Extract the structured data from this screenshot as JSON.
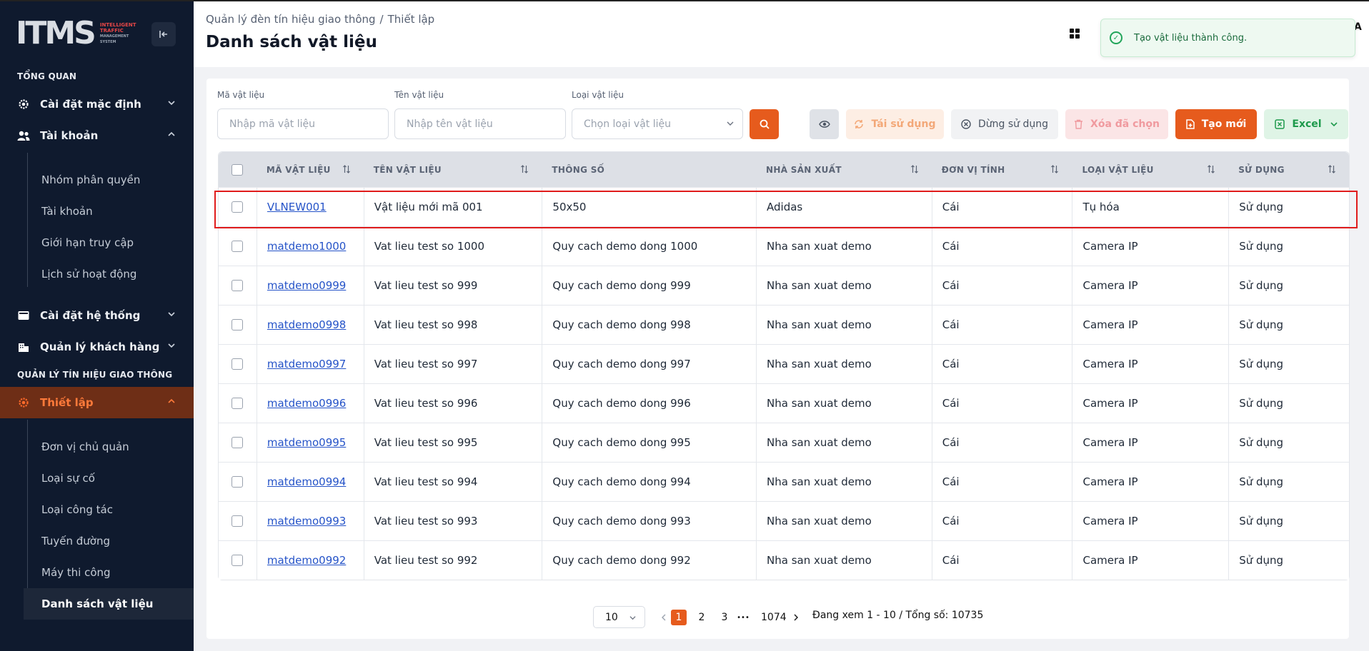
{
  "app": {
    "logo_text": "ITMS",
    "logo_sub": [
      "INTELLIGENT",
      "TRAFFIC",
      "MANAGEMENT",
      "SYSTEM"
    ]
  },
  "sidebar": {
    "section_overview": "TỔNG QUAN",
    "default_settings": "Cài đặt mặc định",
    "account_group": "Tài khoản",
    "account_items": [
      "Nhóm phân quyền",
      "Tài khoản",
      "Giới hạn truy cập",
      "Lịch sử hoạt động"
    ],
    "system_settings": "Cài đặt hệ thống",
    "customer_mgmt": "Quản lý khách hàng",
    "section_traffic": "QUẢN LÝ TÍN HIỆU GIAO THÔNG",
    "setup_group": "Thiết lập",
    "setup_items": [
      "Đơn vị chủ quản",
      "Loại sự cố",
      "Loại công tác",
      "Tuyến đường",
      "Máy thi công",
      "Danh sách vật liệu"
    ]
  },
  "header": {
    "breadcrumb": [
      "Quản lý đèn tín hiệu giao thông",
      "Thiết lập"
    ],
    "breadcrumb_sep": "/",
    "title": "Danh sách vật liệu",
    "user_initial": "A"
  },
  "toast": {
    "message": "Tạo vật liệu thành công."
  },
  "filters": {
    "code_label": "Mã vật liệu",
    "code_placeholder": "Nhập mã vật liệu",
    "name_label": "Tên vật liệu",
    "name_placeholder": "Nhập tên vật liệu",
    "type_label": "Loại vật liệu",
    "type_placeholder": "Chọn loại vật liệu"
  },
  "toolbar": {
    "reuse": "Tái sử dụng",
    "stop_use": "Dừng sử dụng",
    "delete_selected": "Xóa đã chọn",
    "create_new": "Tạo mới",
    "excel": "Excel"
  },
  "table": {
    "columns": [
      "MÃ VẬT LIỆU",
      "TÊN VẬT LIỆU",
      "THÔNG SỐ",
      "NHÀ SẢN XUẤT",
      "ĐƠN VỊ TÍNH",
      "LOẠI VẬT LIỆU",
      "SỬ DỤNG"
    ],
    "rows": [
      [
        "VLNEW001",
        "Vật liệu mới mã 001",
        "50x50",
        "Adidas",
        "Cái",
        "Tụ hóa",
        "Sử dụng"
      ],
      [
        "matdemo1000",
        "Vat lieu test so 1000",
        "Quy cach demo dong 1000",
        "Nha san xuat demo",
        "Cái",
        "Camera IP",
        "Sử dụng"
      ],
      [
        "matdemo0999",
        "Vat lieu test so 999",
        "Quy cach demo dong 999",
        "Nha san xuat demo",
        "Cái",
        "Camera IP",
        "Sử dụng"
      ],
      [
        "matdemo0998",
        "Vat lieu test so 998",
        "Quy cach demo dong 998",
        "Nha san xuat demo",
        "Cái",
        "Camera IP",
        "Sử dụng"
      ],
      [
        "matdemo0997",
        "Vat lieu test so 997",
        "Quy cach demo dong 997",
        "Nha san xuat demo",
        "Cái",
        "Camera IP",
        "Sử dụng"
      ],
      [
        "matdemo0996",
        "Vat lieu test so 996",
        "Quy cach demo dong 996",
        "Nha san xuat demo",
        "Cái",
        "Camera IP",
        "Sử dụng"
      ],
      [
        "matdemo0995",
        "Vat lieu test so 995",
        "Quy cach demo dong 995",
        "Nha san xuat demo",
        "Cái",
        "Camera IP",
        "Sử dụng"
      ],
      [
        "matdemo0994",
        "Vat lieu test so 994",
        "Quy cach demo dong 994",
        "Nha san xuat demo",
        "Cái",
        "Camera IP",
        "Sử dụng"
      ],
      [
        "matdemo0993",
        "Vat lieu test so 993",
        "Quy cach demo dong 993",
        "Nha san xuat demo",
        "Cái",
        "Camera IP",
        "Sử dụng"
      ],
      [
        "matdemo0992",
        "Vat lieu test so 992",
        "Quy cach demo dong 992",
        "Nha san xuat demo",
        "Cái",
        "Camera IP",
        "Sử dụng"
      ]
    ]
  },
  "pagination": {
    "page_size": "10",
    "pages": [
      "1",
      "2",
      "3"
    ],
    "ellipsis": "•••",
    "last_page": "1074",
    "info": "Đang xem 1 - 10 / Tổng số: 10735"
  },
  "colors": {
    "accent": "#e65b1d",
    "sidebar_bg": "#0f1a2e",
    "success": "#22a55a",
    "link": "#2553c8"
  }
}
